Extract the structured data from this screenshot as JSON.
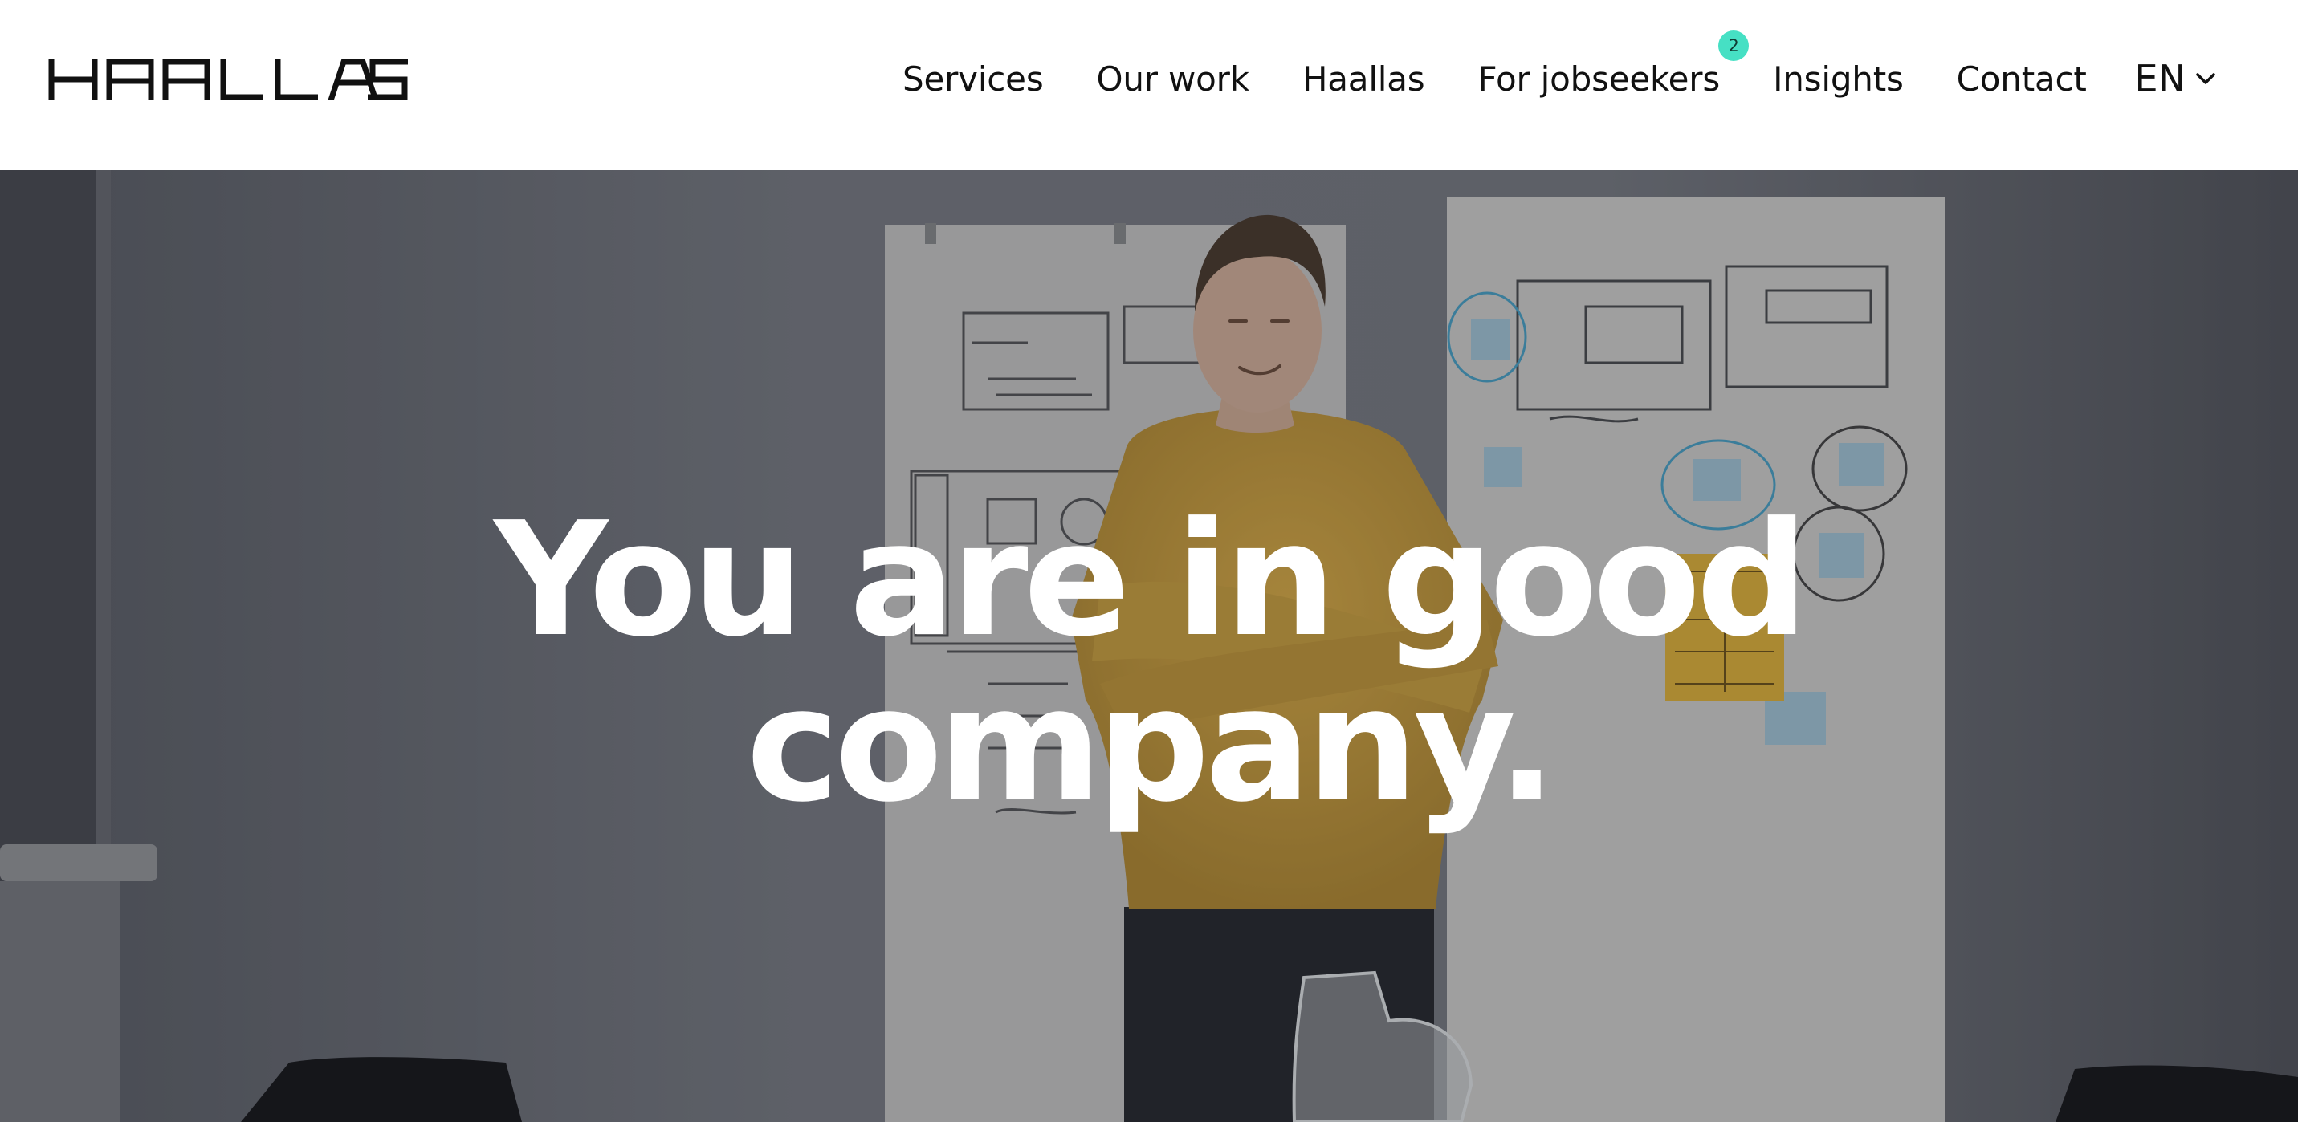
{
  "brand": {
    "name": "HAALLAS",
    "logo_color": "#111111"
  },
  "nav": {
    "items": [
      {
        "label": "Services"
      },
      {
        "label": "Our work"
      },
      {
        "label": "Haallas"
      },
      {
        "label": "For jobseekers",
        "badge": "2"
      },
      {
        "label": "Insights"
      },
      {
        "label": "Contact"
      }
    ],
    "badge_color": "#46e0c4"
  },
  "language": {
    "current": "EN",
    "icon": "chevron-down-icon"
  },
  "hero": {
    "title_line1": "You are in good",
    "title_line2": "company.",
    "sweater_color": "#e2b348"
  }
}
